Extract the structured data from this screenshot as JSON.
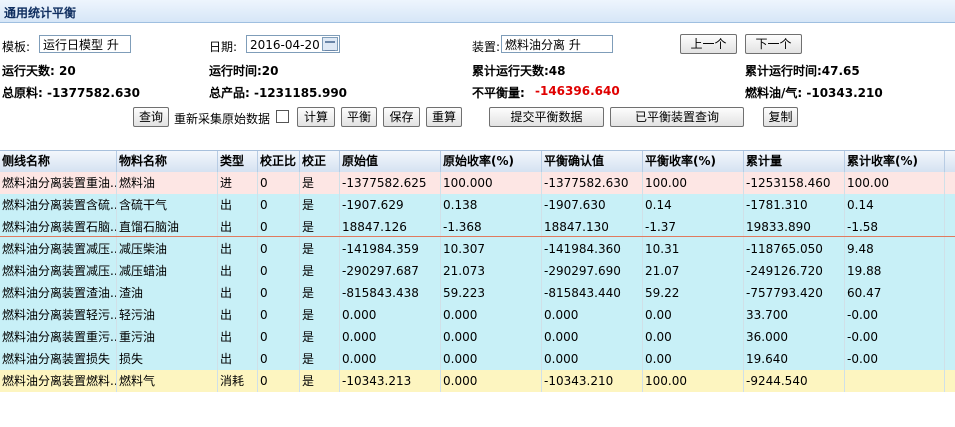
{
  "title": "通用统计平衡",
  "form": {
    "template_label": "模板:",
    "template_value": "运行日模型 升",
    "date_label": "日期:",
    "date_value": "2016-04-20",
    "device_label": "装置:",
    "device_value": "燃料油分离 升",
    "prev_label": "上一个",
    "next_label": "下一个"
  },
  "stats": {
    "run_days": "运行天数: 20",
    "run_time": "运行时间:20",
    "cum_run_days": "累计运行天数:48",
    "cum_run_time": "累计运行时间:47.65",
    "total_raw": "总原料: -1377582.630",
    "total_product": "总产品: -1231185.990",
    "imbalance_label": "不平衡量:",
    "imbalance_value": "-146396.640",
    "fuel_ratio": "燃料油/气: -10343.210"
  },
  "toolbar": {
    "query": "查询",
    "recollect": "重新采集原始数据",
    "calc": "计算",
    "balance": "平衡",
    "save": "保存",
    "redo": "重算",
    "submit": "提交平衡数据",
    "balanced_query": "已平衡装置查询",
    "copy": "复制"
  },
  "table": {
    "columns": [
      "侧线名称",
      "物料名称",
      "类型",
      "校正比",
      "校正",
      "原始值",
      "原始收率(%)",
      "平衡确认值",
      "平衡收率(%)",
      "累计量",
      "累计收率(%)"
    ],
    "rows": [
      {
        "color": "#fde6e4",
        "cells": [
          "燃料油分离装置重油...",
          "燃料油",
          "进",
          "0",
          "是",
          "-1377582.625",
          "100.000",
          "-1377582.630",
          "100.00",
          "-1253158.460",
          "100.00"
        ]
      },
      {
        "color": "#c8f0f7",
        "cells": [
          "燃料油分离装置含硫...",
          "含硫干气",
          "出",
          "0",
          "是",
          "-1907.629",
          "0.138",
          "-1907.630",
          "0.14",
          "-1781.310",
          "0.14"
        ]
      },
      {
        "color": "#c8f0f7",
        "cells": [
          "燃料油分离装置石脑...",
          "直馏石脑油",
          "出",
          "0",
          "是",
          "18847.126",
          "-1.368",
          "18847.130",
          "-1.37",
          "19833.890",
          "-1.58"
        ]
      },
      {
        "color": "#c8f0f7",
        "cells": [
          "燃料油分离装置减压...",
          "减压柴油",
          "出",
          "0",
          "是",
          "-141984.359",
          "10.307",
          "-141984.360",
          "10.31",
          "-118765.050",
          "9.48"
        ]
      },
      {
        "color": "#c8f0f7",
        "cells": [
          "燃料油分离装置减压...",
          "减压蜡油",
          "出",
          "0",
          "是",
          "-290297.687",
          "21.073",
          "-290297.690",
          "21.07",
          "-249126.720",
          "19.88"
        ]
      },
      {
        "color": "#c8f0f7",
        "cells": [
          "燃料油分离装置渣油...",
          "渣油",
          "出",
          "0",
          "是",
          "-815843.438",
          "59.223",
          "-815843.440",
          "59.22",
          "-757793.420",
          "60.47"
        ]
      },
      {
        "color": "#c8f0f7",
        "cells": [
          "燃料油分离装置轻污...",
          "轻污油",
          "出",
          "0",
          "是",
          "0.000",
          "0.000",
          "0.000",
          "0.00",
          "33.700",
          "-0.00"
        ]
      },
      {
        "color": "#c8f0f7",
        "cells": [
          "燃料油分离装置重污...",
          "重污油",
          "出",
          "0",
          "是",
          "0.000",
          "0.000",
          "0.000",
          "0.00",
          "36.000",
          "-0.00"
        ]
      },
      {
        "color": "#c8f0f7",
        "cells": [
          "燃料油分离装置损失",
          "损失",
          "出",
          "0",
          "是",
          "0.000",
          "0.000",
          "0.000",
          "0.00",
          "19.640",
          "-0.00"
        ]
      },
      {
        "color": "#fdf5c0",
        "cells": [
          "燃料油分离装置燃料...",
          "燃料气",
          "消耗",
          "0",
          "是",
          "-10343.213",
          "0.000",
          "-10343.210",
          "100.00",
          "-9244.540",
          ""
        ]
      }
    ]
  }
}
